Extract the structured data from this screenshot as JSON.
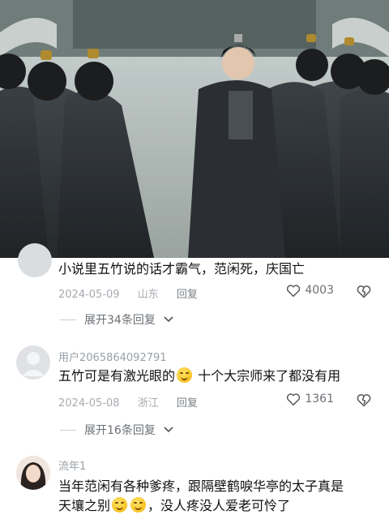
{
  "video": {
    "description_icon": "video-frame-icon"
  },
  "comments": [
    {
      "text": "小说里五竹说的话才霸气，范闲死，庆国亡",
      "date": "2024-05-09",
      "location": "山东",
      "reply_label": "回复",
      "likes": "4003",
      "expand_label": "展开34条回复"
    },
    {
      "user": "用户2065864092791",
      "text_a": "五竹可是有激光眼的",
      "text_b": " 十个大宗师来了都没有用",
      "date": "2024-05-08",
      "location": "浙江",
      "reply_label": "回复",
      "likes": "1361",
      "expand_label": "展开16条回复"
    },
    {
      "user": "流年1",
      "text_line1": "当年范闲有各种爹疼，跟隔壁鹤唳华亭的太子真是",
      "text_line2_a": "天壤之别",
      "text_line2_b": "，没人疼没人爱老可怜了"
    }
  ],
  "icons": {
    "heart": "heart-icon",
    "dislike": "broken-heart-icon",
    "chevron": "chevron-down-icon"
  }
}
